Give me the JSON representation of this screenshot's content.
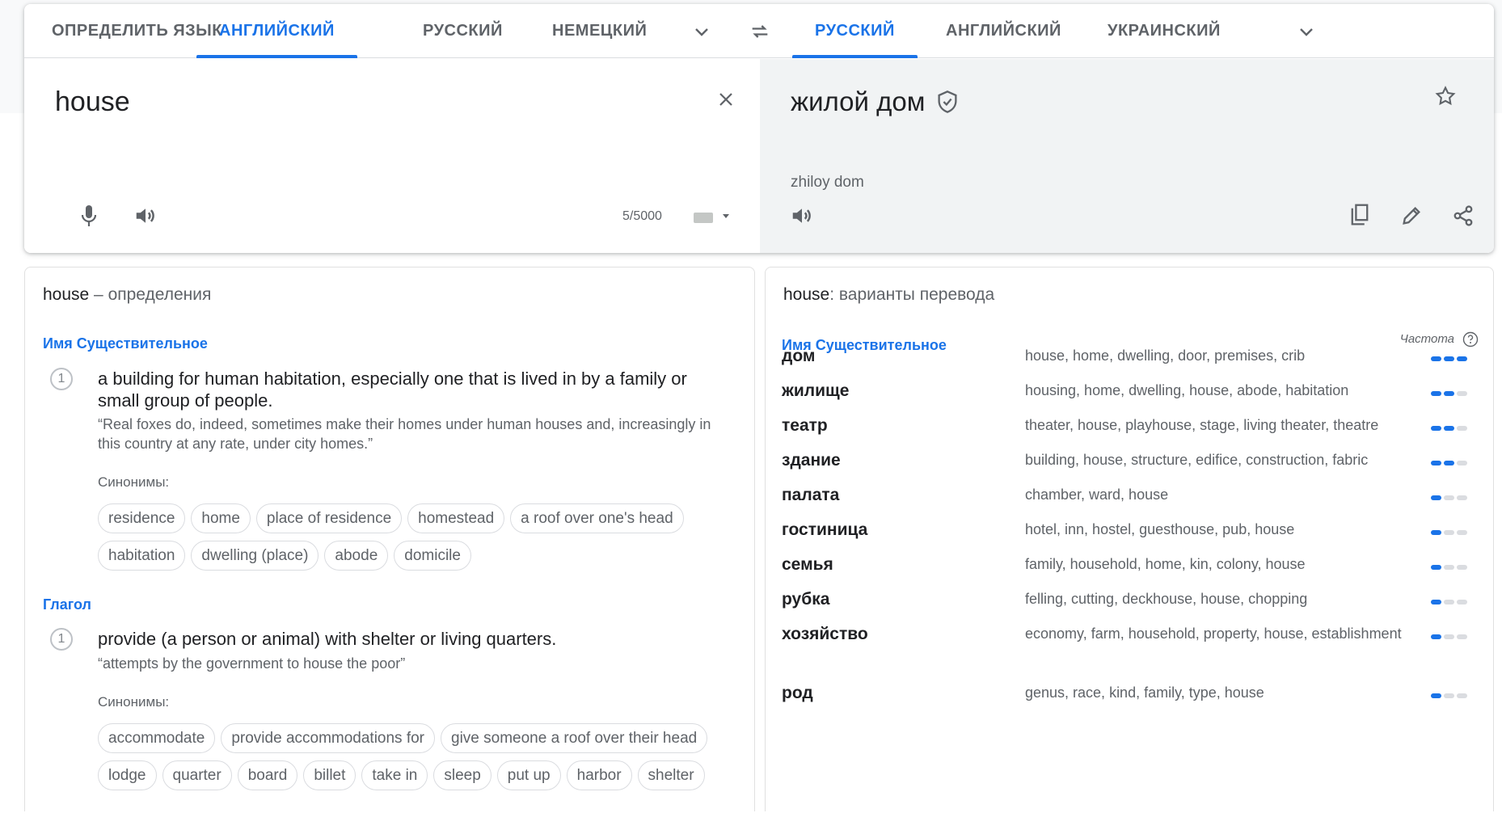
{
  "source_tabs": [
    "ОПРЕДЕЛИТЬ ЯЗЫК",
    "АНГЛИЙСКИЙ",
    "РУССКИЙ",
    "НЕМЕЦКИЙ"
  ],
  "target_tabs": [
    "РУССКИЙ",
    "АНГЛИЙСКИЙ",
    "УКРАИНСКИЙ"
  ],
  "source": {
    "text": "house",
    "counter": "5/5000"
  },
  "target": {
    "text": "жилой дом",
    "transliteration": "zhiloy dom"
  },
  "colors": {
    "accent": "#1a73e8",
    "target_bg": "#f1f3f4"
  },
  "definitions": {
    "heading_word": "house",
    "heading_suffix": " – определения",
    "noun_label": "Имя Существительное",
    "verb_label": "Глагол",
    "noun_num": "1",
    "verb_num": "1",
    "noun_def": "a building for human habitation, especially one that is lived in by a family or small group of people.",
    "noun_example": "“Real foxes do, indeed, sometimes make their homes under human houses and, increasingly in this country at any rate, under city homes.”",
    "syn_label": "Синонимы:",
    "noun_synonyms": [
      "residence",
      "home",
      "place of residence",
      "homestead",
      "a roof over one's head",
      "habitation",
      "dwelling (place)",
      "abode",
      "domicile"
    ],
    "verb_def": "provide (a person or animal) with shelter or living quarters.",
    "verb_example": "“attempts by the government to house the poor”",
    "verb_synonyms": [
      "accommodate",
      "provide accommodations for",
      "give someone a roof over their head",
      "lodge",
      "quarter",
      "board",
      "billet",
      "take in",
      "sleep",
      "put up",
      "harbor",
      "shelter"
    ]
  },
  "translations": {
    "heading_word": "house",
    "heading_suffix": ": варианты перевода",
    "pos_label": "Имя Существительное",
    "freq_label": "Частота",
    "rows": [
      {
        "word": "дом",
        "trans": "house, home, dwelling, door, premises, crib",
        "freq": 3
      },
      {
        "word": "жилище",
        "trans": "housing, home, dwelling, house, abode, habitation",
        "freq": 2
      },
      {
        "word": "театр",
        "trans": "theater, house, playhouse, stage, living theater, theatre",
        "freq": 2
      },
      {
        "word": "здание",
        "trans": "building, house, structure, edifice, construction, fabric",
        "freq": 2
      },
      {
        "word": "палата",
        "trans": "chamber, ward, house",
        "freq": 1
      },
      {
        "word": "гостиница",
        "trans": "hotel, inn, hostel, guesthouse, pub, house",
        "freq": 1
      },
      {
        "word": "семья",
        "trans": "family, household, home, kin, colony, house",
        "freq": 1
      },
      {
        "word": "рубка",
        "trans": "felling, cutting, deckhouse, house, chopping",
        "freq": 1
      },
      {
        "word": "хозяйство",
        "trans": "economy, farm, household, property, house, establishment",
        "freq": 1
      },
      {
        "word": "род",
        "trans": "genus, race, kind, family, type, house",
        "freq": 1
      }
    ]
  }
}
